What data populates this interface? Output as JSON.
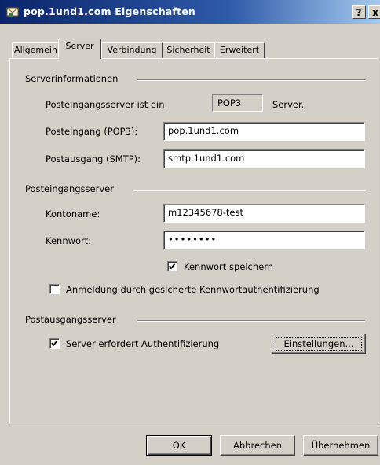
{
  "window": {
    "title": "pop.1und1.com Eigenschaften",
    "help_label": "?",
    "close_label": "x"
  },
  "tabs": [
    {
      "label": "Allgemein",
      "active": false
    },
    {
      "label": "Server",
      "active": true
    },
    {
      "label": "Verbindung",
      "active": false
    },
    {
      "label": "Sicherheit",
      "active": false
    },
    {
      "label": "Erweitert",
      "active": false
    }
  ],
  "server_info": {
    "group_title": "Serverinformationen",
    "incoming_type_label": "Posteingangsserver ist ein",
    "incoming_type_value": "POP3",
    "incoming_type_suffix": "Server.",
    "incoming_label": "Posteingang (POP3):",
    "incoming_value": "pop.1und1.com",
    "outgoing_label": "Postausgang (SMTP):",
    "outgoing_value": "smtp.1und1.com"
  },
  "incoming_server": {
    "group_title": "Posteingangsserver",
    "account_label": "Kontoname:",
    "account_value": "m12345678-test",
    "password_label": "Kennwort:",
    "password_value": "••••••••",
    "save_password_label": "Kennwort speichern",
    "save_password_checked": true,
    "spa_label": "Anmeldung durch gesicherte Kennwortauthentifizierung",
    "spa_checked": false
  },
  "outgoing_server": {
    "group_title": "Postausgangsserver",
    "auth_label": "Server erfordert Authentifizierung",
    "auth_checked": true,
    "settings_button": "Einstellungen..."
  },
  "buttons": {
    "ok": "OK",
    "cancel": "Abbrechen",
    "apply": "Übernehmen"
  }
}
